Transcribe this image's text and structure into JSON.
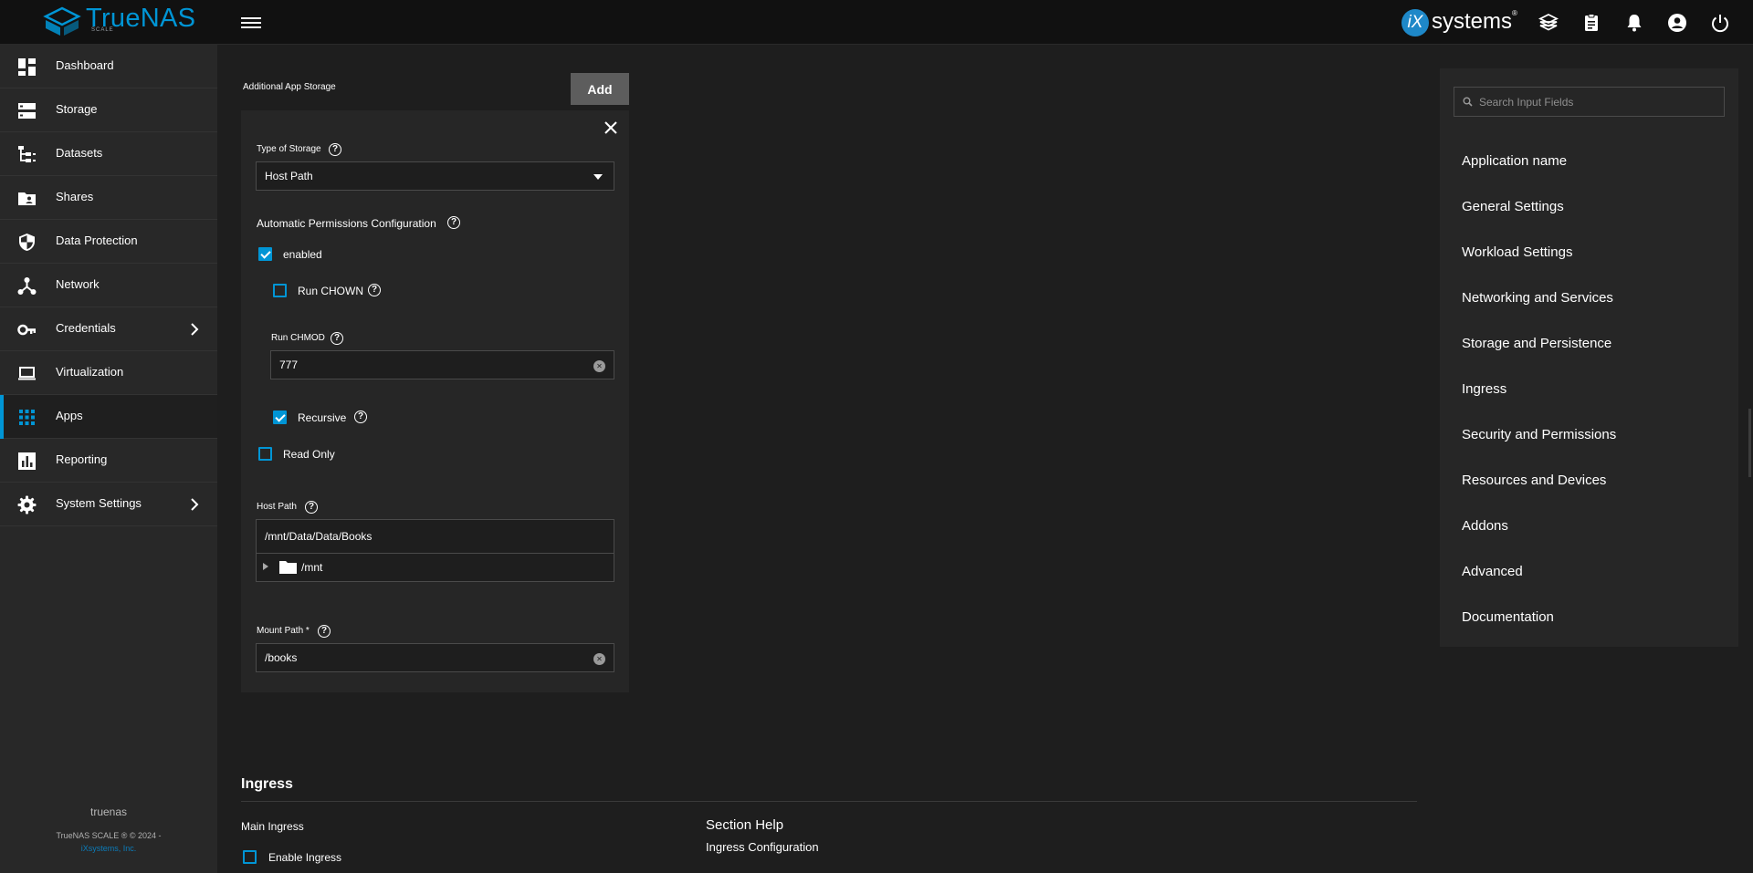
{
  "topbar": {
    "logo_text": "TrueNAS",
    "logo_sub": "SCALE",
    "brand_ix": "iX",
    "brand_name": "systems",
    "brand_mark": "®"
  },
  "sidebar": {
    "items": [
      {
        "label": "Dashboard"
      },
      {
        "label": "Storage"
      },
      {
        "label": "Datasets"
      },
      {
        "label": "Shares"
      },
      {
        "label": "Data Protection"
      },
      {
        "label": "Network"
      },
      {
        "label": "Credentials"
      },
      {
        "label": "Virtualization"
      },
      {
        "label": "Apps"
      },
      {
        "label": "Reporting"
      },
      {
        "label": "System Settings"
      }
    ],
    "hostname": "truenas",
    "copyright": "TrueNAS SCALE ® © 2024 -",
    "company_link": "iXsystems, Inc."
  },
  "form": {
    "section_label": "Additional App Storage",
    "add_label": "Add",
    "type_of_storage_label": "Type of Storage",
    "type_of_storage_value": "Host Path",
    "auto_perm_label": "Automatic Permissions Configuration",
    "enabled_label": "enabled",
    "run_chown_label": "Run CHOWN",
    "run_chmod_label": "Run CHMOD",
    "run_chmod_value": "777",
    "recursive_label": "Recursive",
    "read_only_label": "Read Only",
    "host_path_label": "Host Path",
    "host_path_value": "/mnt/Data/Data/Books",
    "tree_node": "/mnt",
    "mount_path_label": "Mount Path *",
    "mount_path_value": "/books",
    "ingress_title": "Ingress",
    "main_ingress_label": "Main Ingress",
    "enable_ingress_label": "Enable Ingress",
    "section_help_title": "Section Help",
    "section_help_text": "Ingress Configuration"
  },
  "right_panel": {
    "search_placeholder": "Search Input Fields",
    "items": [
      "Application name",
      "General Settings",
      "Workload Settings",
      "Networking and Services",
      "Storage and Persistence",
      "Ingress",
      "Security and Permissions",
      "Resources and Devices",
      "Addons",
      "Advanced",
      "Documentation"
    ]
  },
  "colors": {
    "accent": "#0095d5",
    "topbar_bg": "#111111",
    "sidebar_bg": "#282828",
    "main_bg": "#1e1e1e",
    "card_bg": "#262626"
  }
}
